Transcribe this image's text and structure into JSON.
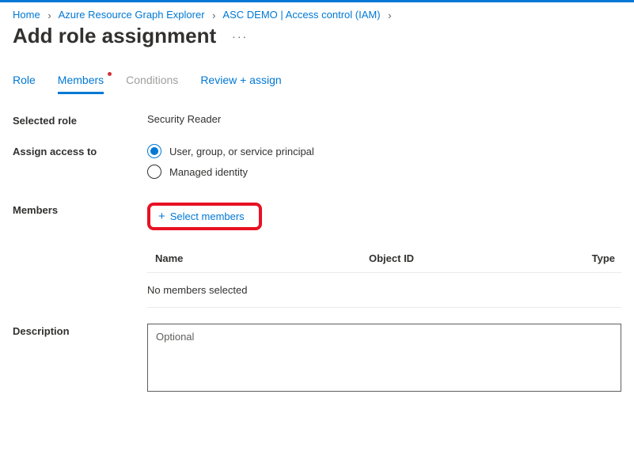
{
  "breadcrumb": {
    "home": "Home",
    "arg": "Azure Resource Graph Explorer",
    "iam": "ASC DEMO | Access control (IAM)"
  },
  "page_title": "Add role assignment",
  "tabs": {
    "role": "Role",
    "members": "Members",
    "conditions": "Conditions",
    "review": "Review + assign"
  },
  "labels": {
    "selected_role": "Selected role",
    "assign_access_to": "Assign access to",
    "members": "Members",
    "description": "Description"
  },
  "values": {
    "selected_role": "Security Reader"
  },
  "assign_options": {
    "user": "User, group, or service principal",
    "managed": "Managed identity"
  },
  "select_members_label": "Select members",
  "table": {
    "col_name": "Name",
    "col_object": "Object ID",
    "col_type": "Type",
    "empty": "No members selected"
  },
  "description_placeholder": "Optional"
}
